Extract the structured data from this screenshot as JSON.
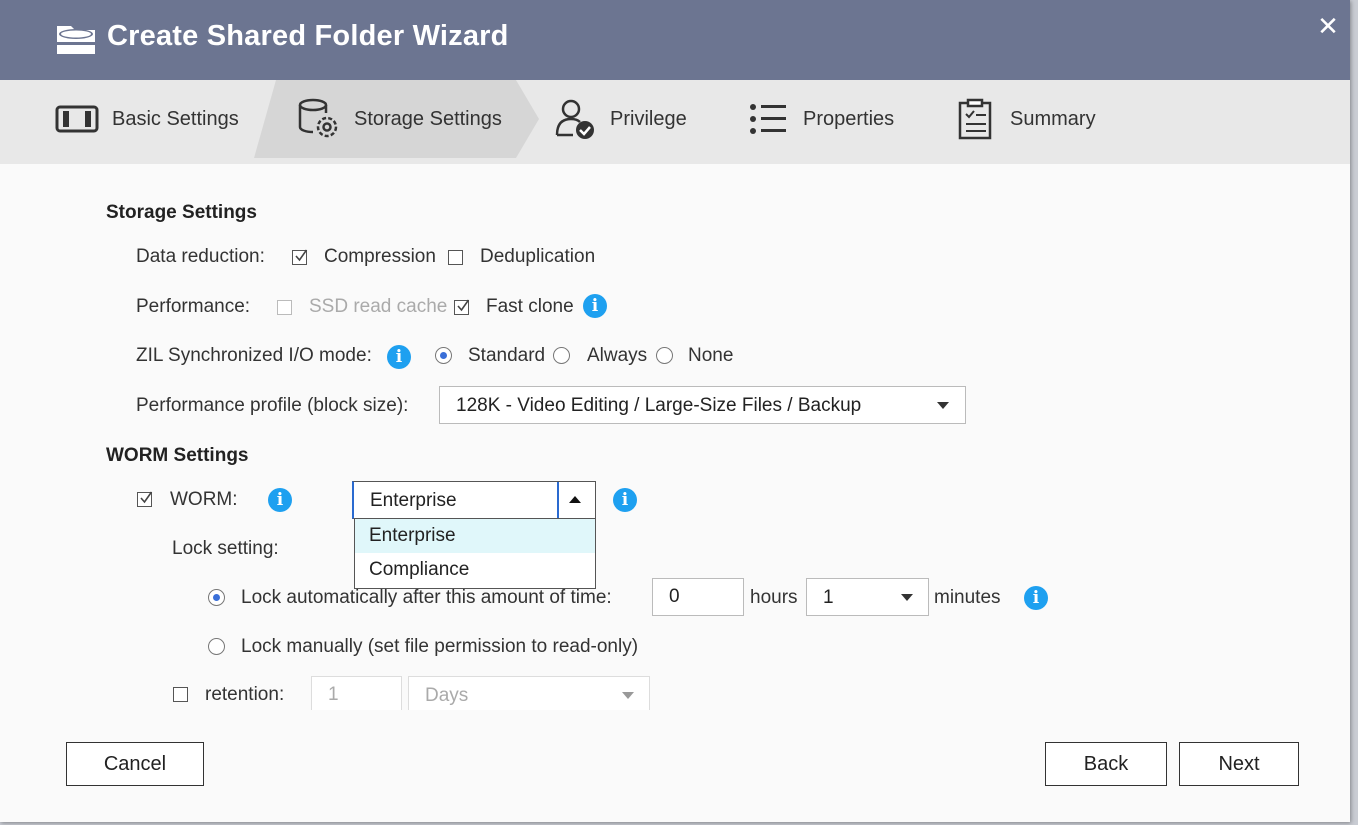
{
  "window": {
    "title": "Create Shared Folder Wizard",
    "close_symbol": "✕"
  },
  "steps": [
    {
      "label": "Basic Settings",
      "icon": "folder-drive-icon"
    },
    {
      "label": "Storage Settings",
      "icon": "storage-gear-icon",
      "active": true
    },
    {
      "label": "Privilege",
      "icon": "user-check-icon"
    },
    {
      "label": "Properties",
      "icon": "list-icon"
    },
    {
      "label": "Summary",
      "icon": "clipboard-icon"
    }
  ],
  "storage": {
    "title": "Storage Settings",
    "data_reduction_label": "Data reduction:",
    "compression_label": "Compression",
    "compression_checked": true,
    "dedup_label": "Deduplication",
    "dedup_checked": false,
    "performance_label": "Performance:",
    "ssd_cache_label": "SSD read cache",
    "ssd_cache_checked": false,
    "fast_clone_label": "Fast clone",
    "fast_clone_checked": true,
    "zil_label": "ZIL Synchronized I/O mode:",
    "zil_options": [
      "Standard",
      "Always",
      "None"
    ],
    "zil_selected": "Standard",
    "profile_label": "Performance profile (block size):",
    "profile_value": "128K - Video Editing / Large-Size Files / Backup"
  },
  "worm": {
    "title": "WORM Settings",
    "worm_label": "WORM:",
    "worm_checked": true,
    "mode_value": "Enterprise",
    "mode_options": [
      "Enterprise",
      "Compliance"
    ],
    "lock_setting_label": "Lock setting:",
    "lock_auto_label": "Lock automatically after this amount of time:",
    "lock_auto_selected": true,
    "hours_value": "0",
    "hours_label": "hours",
    "minutes_value": "1",
    "minutes_label": "minutes",
    "lock_manual_label": "Lock manually (set file permission to read-only)",
    "retention_label": "retention:",
    "retention_checked": false,
    "retention_value": "1",
    "retention_unit": "Days"
  },
  "footer": {
    "cancel": "Cancel",
    "back": "Back",
    "next": "Next"
  },
  "colors": {
    "titlebar": "#6c7591",
    "info": "#1ea0f0",
    "radio": "#3a6fd8",
    "dropdown_highlight": "#e0f7fa"
  }
}
